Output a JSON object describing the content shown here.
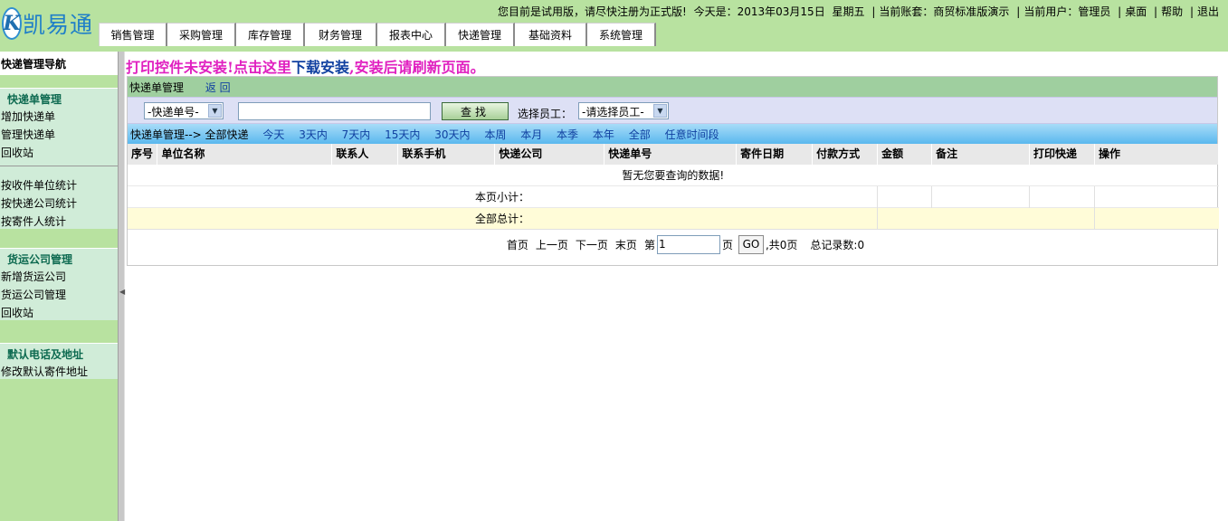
{
  "header": {
    "logo_letter": "K",
    "logo_text": "凯易通",
    "trial_notice": "您目前是试用版，请尽快注册为正式版!",
    "today_label": "今天是：2013年03月15日",
    "weekday": "星期五",
    "account_label": "当前账套：商贸标准版演示",
    "user_label": "当前用户：管理员",
    "desktop_link": "桌面",
    "help_link": "帮助",
    "logout_link": "退出",
    "nav": [
      "销售管理",
      "采购管理",
      "库存管理",
      "财务管理",
      "报表中心",
      "快递管理",
      "基础资料",
      "系统管理"
    ]
  },
  "sidebar": {
    "title": "快递管理导航",
    "groups": [
      {
        "head": "快递单管理",
        "items": [
          "增加快递单",
          "管理快递单",
          "回收站"
        ]
      },
      {
        "items": [
          "按收件单位统计",
          "按快递公司统计",
          "按寄件人统计"
        ]
      },
      {
        "head": "货运公司管理",
        "items": [
          "新增货运公司",
          "货运公司管理",
          "回收站"
        ]
      },
      {
        "head": "默认电话及地址",
        "items": [
          "修改默认寄件地址"
        ]
      }
    ]
  },
  "main": {
    "warning_part1": "打印控件未安装!点击这里",
    "warning_link": "下载安装",
    "warning_part2": ",安装后请刷新页面。",
    "module_title": "快递单管理",
    "back_link": "返 回",
    "search": {
      "type_select": "-快递单号-",
      "keyword": "",
      "find_button": "查找",
      "employee_label": "选择员工：",
      "employee_select": "-请选择员工-"
    },
    "filter_prefix": "快递单管理--> 全部快递",
    "filters": [
      "今天",
      "3天内",
      "7天内",
      "15天内",
      "30天内",
      "本周",
      "本月",
      "本季",
      "本年",
      "全部",
      "任意时间段"
    ],
    "columns": [
      "序号",
      "单位名称",
      "联系人",
      "联系手机",
      "快递公司",
      "快递单号",
      "寄件日期",
      "付款方式",
      "金额",
      "备注",
      "打印快递",
      "操作"
    ],
    "empty_message": "暂无您要查询的数据!",
    "page_subtotal": "本页小计：",
    "grand_total": "全部总计：",
    "pager": {
      "first": "首页",
      "prev": "上一页",
      "next": "下一页",
      "last": "末页",
      "page_prefix": "第",
      "page_value": "1",
      "page_suffix": "页",
      "go": "GO",
      "total_pages": ",共0页",
      "record_count": "总记录数:0"
    }
  }
}
